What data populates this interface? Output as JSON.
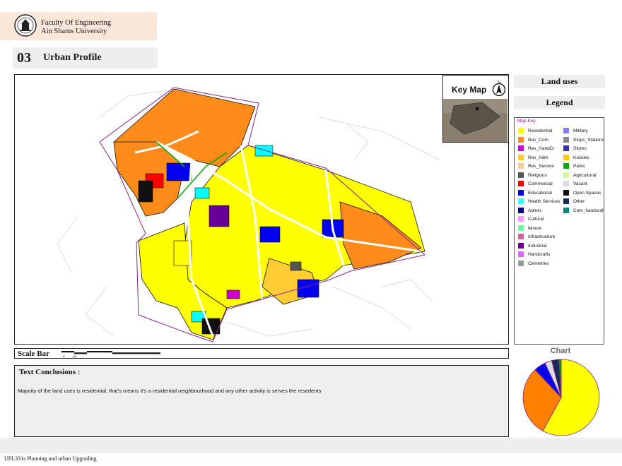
{
  "header": {
    "faculty_line1": "Faculty Of Engineering",
    "faculty_line2": "Ain Shams University"
  },
  "section": {
    "number": "03",
    "title": "Urban Profile"
  },
  "keymap": {
    "title": "Key Map"
  },
  "side": {
    "land_uses": "Land uses",
    "legend": "Legend"
  },
  "legend": {
    "title": "Map Key",
    "left_items": [
      {
        "label": "Resedential",
        "color": "#ffff00"
      },
      {
        "label": "Res_Com",
        "color": "#ff8c1a"
      },
      {
        "label": "Res_HandCr",
        "color": "#cc00cc"
      },
      {
        "label": "Res_Adm",
        "color": "#ffcc33"
      },
      {
        "label": "Res_Service",
        "color": "#ffcc99"
      },
      {
        "label": "Religious",
        "color": "#555555"
      },
      {
        "label": "Commercial",
        "color": "#ff0000"
      },
      {
        "label": "Educational",
        "color": "#0000ee"
      },
      {
        "label": "Health Services",
        "color": "#33ffff"
      },
      {
        "label": "Admin.",
        "color": "#000080"
      },
      {
        "label": "Cultural",
        "color": "#ff99ff"
      },
      {
        "label": "leisure",
        "color": "#66ff99"
      },
      {
        "label": "Infrastructure",
        "color": "#cc6699"
      },
      {
        "label": "Industrial",
        "color": "#660099"
      },
      {
        "label": "Handcrafts",
        "color": "#dd66ff"
      },
      {
        "label": "Cemetries",
        "color": "#999999"
      }
    ],
    "right_items": [
      {
        "label": "Military",
        "color": "#8080ff"
      },
      {
        "label": "Stops_Stations",
        "color": "#888888"
      },
      {
        "label": "Stores",
        "color": "#3333aa"
      },
      {
        "label": "Koisoks",
        "color": "#ffcc00"
      },
      {
        "label": "Parks",
        "color": "#00aa00"
      },
      {
        "label": "Agricultural",
        "color": "#ccff99"
      },
      {
        "label": "Vacant",
        "color": "#dddddd"
      },
      {
        "label": "Open Spaces",
        "color": "#111111"
      },
      {
        "label": "Other",
        "color": "#1a2a5a"
      },
      {
        "label": "Com_handcraf",
        "color": "#008877"
      }
    ]
  },
  "scalebar": {
    "label": "Scale Bar",
    "tick_0": "0",
    "tick_1": "40"
  },
  "conclusions": {
    "title": "Text Conclusions :",
    "text": "Majority of the land uses is residential, that's means it's a residential neighbourhood and any other activity is serves the resedents"
  },
  "chart_data": {
    "type": "pie",
    "title": "Chart",
    "categories": [
      "Resedential",
      "Res_Com",
      "Educational",
      "Vacant",
      "Other",
      "Parks"
    ],
    "values": [
      58,
      30,
      5,
      3,
      3,
      1
    ],
    "colors": [
      "#ffff00",
      "#ff8000",
      "#0000ee",
      "#dddddd",
      "#1a2a5a",
      "#00aa00"
    ]
  },
  "footer": {
    "text": "UPL331s Planning and urban Upgrading"
  }
}
